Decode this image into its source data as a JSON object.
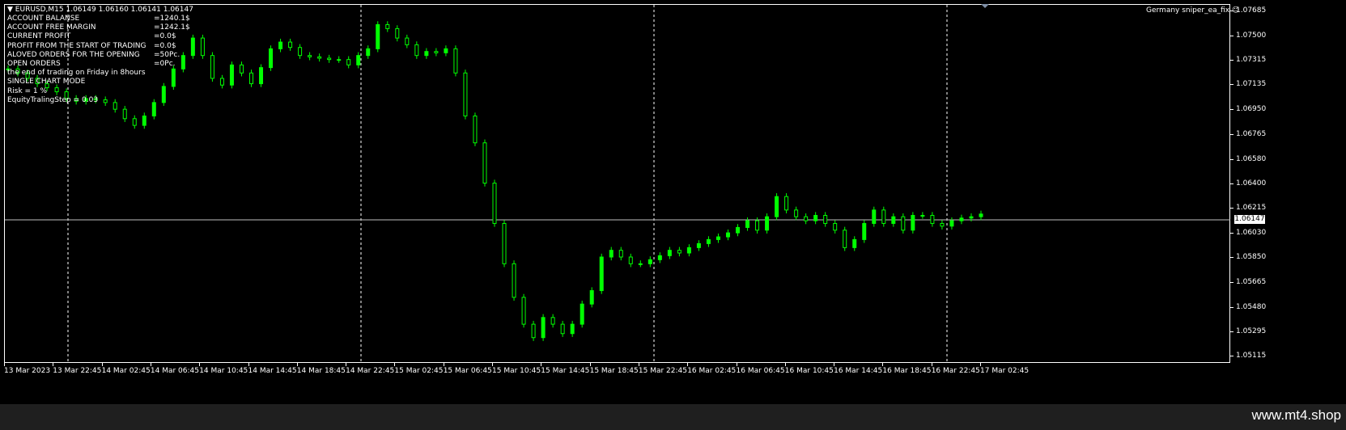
{
  "header": {
    "symbol_line": "EURUSD,M15  1.06149 1.06160 1.06141 1.06147",
    "ea_name": "Germany sniper_ea_fix"
  },
  "info_panel": {
    "rows": [
      {
        "label": "ACCOUNT BALANSE",
        "value": "=1240.1$"
      },
      {
        "label": "ACCOUNT FREE MARGIN",
        "value": "=1242.1$"
      },
      {
        "label": "CURRENT PROFIT",
        "value": "=0.0$"
      },
      {
        "label": "PROFIT FROM THE START OF TRADING",
        "value": "=0.0$"
      },
      {
        "label": "ALOVED ORDERS FOR THE OPENING",
        "value": "=50Pc."
      },
      {
        "label": "OPEN ORDERS",
        "value": "=0Pc."
      }
    ],
    "lines": [
      "the end of trading on Friday in 8hours",
      "SINGLE CHART MODE",
      "Risk = 1 %",
      "EquityTralingStep = 0.03"
    ]
  },
  "current_price": "1.06147",
  "footer": {
    "watermark": "www.mt4.shop"
  },
  "colors": {
    "background": "#000000",
    "candles": "#00ff00",
    "axis_text": "#ffffff",
    "footer": "#1f1f1f"
  },
  "chart_data": {
    "type": "line",
    "title": "EURUSD,M15",
    "ylim": [
      1.0511,
      1.07685
    ],
    "y_ticks": [
      "1.07685",
      "1.07500",
      "1.07315",
      "1.07135",
      "1.06950",
      "1.06765",
      "1.06580",
      "1.06400",
      "1.06215",
      "1.06030",
      "1.05850",
      "1.05665",
      "1.05480",
      "1.05295",
      "1.05115"
    ],
    "x_ticks": [
      "13 Mar 2023",
      "13 Mar 22:45",
      "14 Mar 02:45",
      "14 Mar 06:45",
      "14 Mar 10:45",
      "14 Mar 14:45",
      "14 Mar 18:45",
      "14 Mar 22:45",
      "15 Mar 02:45",
      "15 Mar 06:45",
      "15 Mar 10:45",
      "15 Mar 14:45",
      "15 Mar 18:45",
      "15 Mar 22:45",
      "16 Mar 02:45",
      "16 Mar 06:45",
      "16 Mar 10:45",
      "16 Mar 14:45",
      "16 Mar 18:45",
      "16 Mar 22:45",
      "17 Mar 02:45"
    ],
    "series": [
      {
        "values": [
          1.0725,
          1.0722,
          1.0718,
          1.0714,
          1.0711,
          1.0708,
          1.0703,
          1.0701,
          1.0703,
          1.0702,
          1.07,
          1.0695,
          1.0688,
          1.0683,
          1.069,
          1.07,
          1.0712,
          1.0725,
          1.0735,
          1.0748,
          1.0735,
          1.0718,
          1.0713,
          1.0728,
          1.0722,
          1.0714,
          1.0726,
          1.074,
          1.0745,
          1.0741,
          1.0735,
          1.0734,
          1.0733,
          1.0732,
          1.0732,
          1.0728,
          1.0735,
          1.074,
          1.0758,
          1.0755,
          1.0748,
          1.0743,
          1.0735,
          1.0738,
          1.0737,
          1.074,
          1.0722,
          1.069,
          1.067,
          1.064,
          1.061,
          1.058,
          1.0555,
          1.0535,
          1.0525,
          1.054,
          1.0535,
          1.0528,
          1.0535,
          1.055,
          1.056,
          1.0585,
          1.059,
          1.0585,
          1.058,
          1.058,
          1.0583,
          1.0586,
          1.059,
          1.0588,
          1.0592,
          1.0595,
          1.0598,
          1.06,
          1.0603,
          1.0607,
          1.0612,
          1.0605,
          1.0615,
          1.063,
          1.062,
          1.0615,
          1.0612,
          1.0616,
          1.061,
          1.0605,
          1.0592,
          1.0598,
          1.061,
          1.062,
          1.061,
          1.0615,
          1.0605,
          1.0616,
          1.0616,
          1.061,
          1.0608,
          1.0612,
          1.0614,
          1.0615,
          1.0617
        ]
      }
    ]
  }
}
